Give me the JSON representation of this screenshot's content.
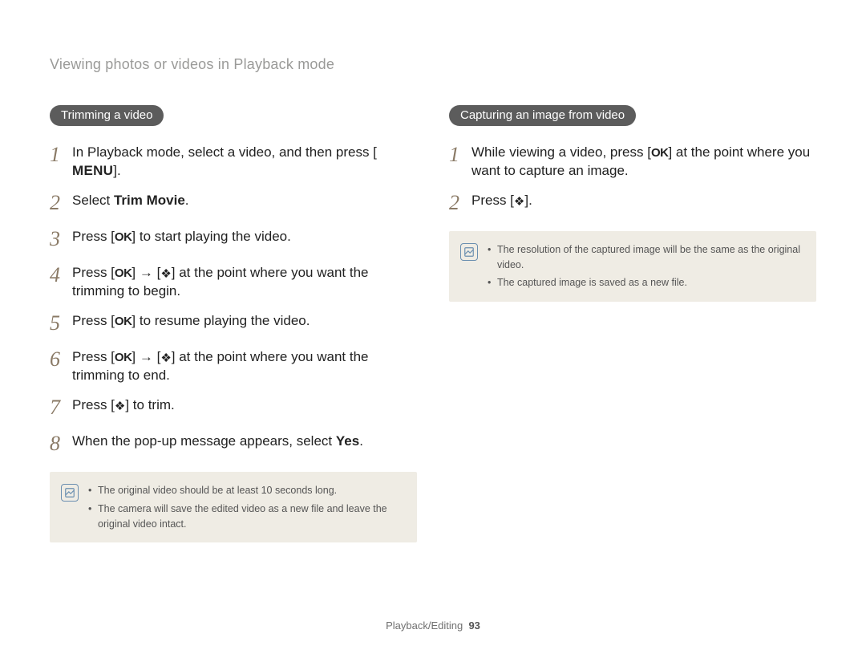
{
  "breadcrumb": "Viewing photos or videos in Playback mode",
  "left": {
    "heading": "Trimming a video",
    "steps": [
      {
        "num": "1",
        "pre": "In Playback mode, select a video, and then press [",
        "icon": "menu",
        "post": "]."
      },
      {
        "num": "2",
        "pre": "Select ",
        "bold": "Trim Movie",
        "post": "."
      },
      {
        "num": "3",
        "pre": "Press [",
        "icon": "ok",
        "post": "] to start playing the video."
      },
      {
        "num": "4",
        "pre": "Press [",
        "icon": "ok",
        "mid1": "] → [",
        "icon2": "flower",
        "post": "] at the point where you want the trimming to begin."
      },
      {
        "num": "5",
        "pre": "Press [",
        "icon": "ok",
        "post": "] to resume playing the video."
      },
      {
        "num": "6",
        "pre": "Press [",
        "icon": "ok",
        "mid1": "] → [",
        "icon2": "flower",
        "post": "] at the point where you want the trimming to end."
      },
      {
        "num": "7",
        "pre": "Press [",
        "icon": "flower",
        "post": "] to trim."
      },
      {
        "num": "8",
        "pre": "When the pop-up message appears, select ",
        "bold": "Yes",
        "post": "."
      }
    ],
    "notes": [
      "The original video should be at least 10 seconds long.",
      "The camera will save the edited video as a new file and leave the original video intact."
    ]
  },
  "right": {
    "heading": "Capturing an image from video",
    "steps": [
      {
        "num": "1",
        "pre": "While viewing a video, press [",
        "icon": "ok",
        "post": "] at the point where you want to capture an image."
      },
      {
        "num": "2",
        "pre": "Press [",
        "icon": "flower",
        "post": "]."
      }
    ],
    "notes": [
      "The resolution of the captured image will be the same as the original video.",
      "The captured image is saved as a new file."
    ]
  },
  "footer": {
    "section": "Playback/Editing",
    "page": "93"
  }
}
